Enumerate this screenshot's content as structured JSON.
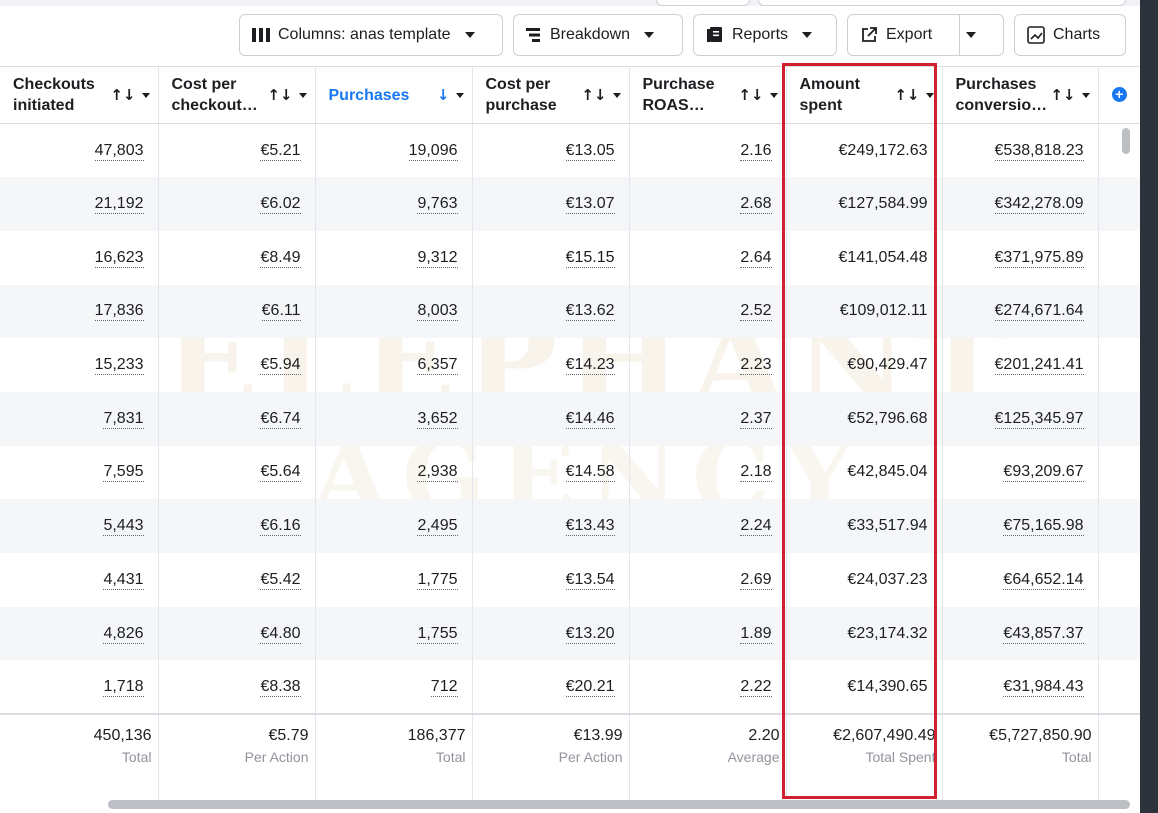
{
  "toolbar": {
    "columns_label": "Columns: anas template",
    "breakdown_label": "Breakdown",
    "reports_label": "Reports",
    "export_label": "Export",
    "charts_label": "Charts"
  },
  "columns": [
    {
      "label": "Checkouts initiated",
      "sort": "↑↓"
    },
    {
      "label": "Cost per checkout…",
      "sort": "↑↓"
    },
    {
      "label": "Purchases",
      "sort": "↓"
    },
    {
      "label": "Cost per purchase",
      "sort": "↑↓"
    },
    {
      "label": "Purchase ROAS…",
      "sort": "↑↓"
    },
    {
      "label": "Amount spent",
      "sort": "↑↓"
    },
    {
      "label": "Purchases conversio…",
      "sort": "↑↓"
    }
  ],
  "rows": [
    [
      "47,803",
      "€5.21",
      "19,096",
      "€13.05",
      "2.16",
      "€249,172.63",
      "€538,818.23"
    ],
    [
      "21,192",
      "€6.02",
      "9,763",
      "€13.07",
      "2.68",
      "€127,584.99",
      "€342,278.09"
    ],
    [
      "16,623",
      "€8.49",
      "9,312",
      "€15.15",
      "2.64",
      "€141,054.48",
      "€371,975.89"
    ],
    [
      "17,836",
      "€6.11",
      "8,003",
      "€13.62",
      "2.52",
      "€109,012.11",
      "€274,671.64"
    ],
    [
      "15,233",
      "€5.94",
      "6,357",
      "€14.23",
      "2.23",
      "€90,429.47",
      "€201,241.41"
    ],
    [
      "7,831",
      "€6.74",
      "3,652",
      "€14.46",
      "2.37",
      "€52,796.68",
      "€125,345.97"
    ],
    [
      "7,595",
      "€5.64",
      "2,938",
      "€14.58",
      "2.18",
      "€42,845.04",
      "€93,209.67"
    ],
    [
      "5,443",
      "€6.16",
      "2,495",
      "€13.43",
      "2.24",
      "€33,517.94",
      "€75,165.98"
    ],
    [
      "4,431",
      "€5.42",
      "1,775",
      "€13.54",
      "2.69",
      "€24,037.23",
      "€64,652.14"
    ],
    [
      "4,826",
      "€4.80",
      "1,755",
      "€13.20",
      "1.89",
      "€23,174.32",
      "€43,857.37"
    ],
    [
      "1,718",
      "€8.38",
      "712",
      "€20.21",
      "2.22",
      "€14,390.65",
      "€31,984.43"
    ]
  ],
  "totals": [
    {
      "value": "450,136",
      "sub": "Total"
    },
    {
      "value": "€5.79",
      "sub": "Per Action"
    },
    {
      "value": "186,377",
      "sub": "Total"
    },
    {
      "value": "€13.99",
      "sub": "Per Action"
    },
    {
      "value": "2.20",
      "sub": "Average"
    },
    {
      "value": "€2,607,490.49",
      "sub": "Total Spent"
    },
    {
      "value": "€5,727,850.90",
      "sub": "Total"
    }
  ],
  "watermark": {
    "line1": "ELEPHANT",
    "line2": "AGENCY"
  },
  "colors": {
    "accent": "#1877f2",
    "highlight": "#d0202f"
  }
}
